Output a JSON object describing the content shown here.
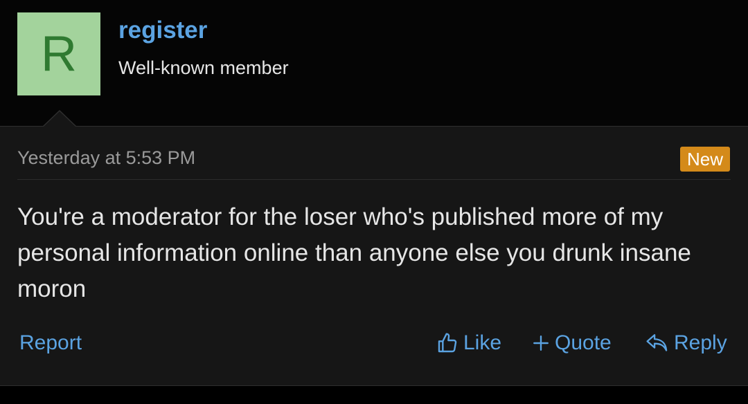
{
  "user": {
    "avatar_letter": "R",
    "username": "register",
    "title": "Well-known member"
  },
  "post": {
    "timestamp": "Yesterday at 5:53 PM",
    "badge": "New",
    "message": "You're a moderator for the loser who's published more of my personal information online than anyone else you drunk insane moron"
  },
  "actions": {
    "report": "Report",
    "like": "Like",
    "quote": "Quote",
    "reply": "Reply"
  },
  "icons": {
    "like": "thumbs-up-icon",
    "quote": "plus-icon",
    "reply": "reply-arrow-icon"
  },
  "colors": {
    "link": "#5ba3e2",
    "avatar_bg": "#a3d39c",
    "avatar_letter": "#2f7a31",
    "badge": "#d48a1a"
  }
}
